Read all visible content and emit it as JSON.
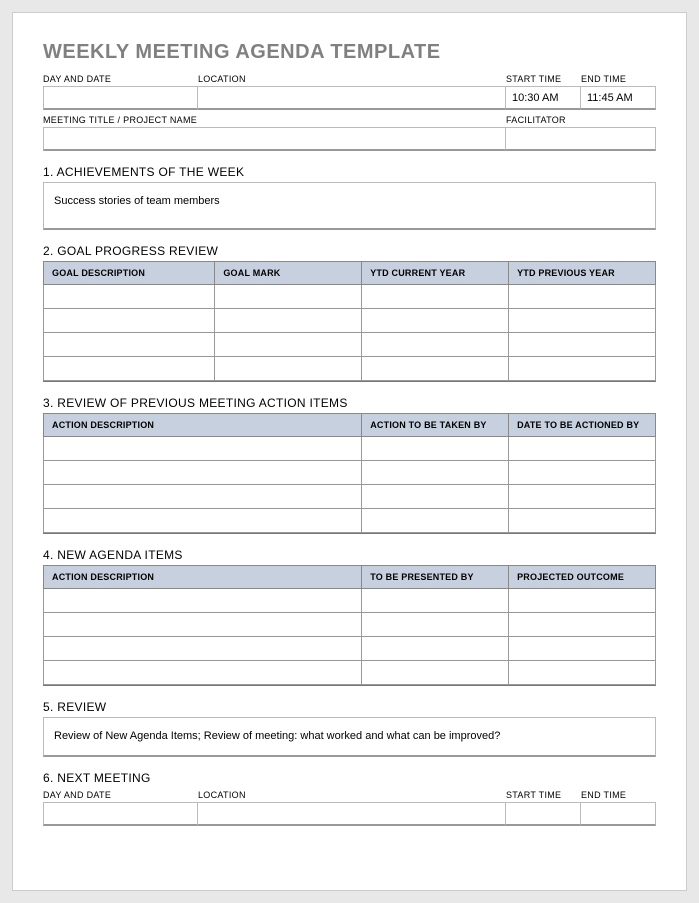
{
  "title": "WEEKLY MEETING AGENDA TEMPLATE",
  "meta1": {
    "day_date_label": "DAY AND DATE",
    "day_date_value": "",
    "location_label": "LOCATION",
    "location_value": "",
    "start_time_label": "START TIME",
    "start_time_value": "10:30 AM",
    "end_time_label": "END TIME",
    "end_time_value": "11:45 AM"
  },
  "meta2": {
    "meeting_title_label": "MEETING TITLE / PROJECT NAME",
    "meeting_title_value": "",
    "facilitator_label": "FACILITATOR",
    "facilitator_value": ""
  },
  "s1": {
    "heading": "1. ACHIEVEMENTS OF THE WEEK",
    "body": "Success stories of team members"
  },
  "s2": {
    "heading": "2. GOAL PROGRESS REVIEW",
    "cols": {
      "c0": "GOAL DESCRIPTION",
      "c1": "GOAL MARK",
      "c2": "YTD CURRENT YEAR",
      "c3": "YTD PREVIOUS YEAR"
    }
  },
  "s3": {
    "heading": "3. REVIEW OF PREVIOUS MEETING ACTION ITEMS",
    "cols": {
      "c0": "ACTION DESCRIPTION",
      "c1": "ACTION TO BE TAKEN BY",
      "c2": "DATE TO BE ACTIONED BY"
    }
  },
  "s4": {
    "heading": "4. NEW AGENDA ITEMS",
    "cols": {
      "c0": "ACTION DESCRIPTION",
      "c1": "TO BE PRESENTED BY",
      "c2": "PROJECTED OUTCOME"
    }
  },
  "s5": {
    "heading": "5. REVIEW",
    "body": "Review of New Agenda Items; Review of meeting: what worked and what can be improved?"
  },
  "s6": {
    "heading": "6. NEXT MEETING",
    "day_date_label": "DAY AND DATE",
    "day_date_value": "",
    "location_label": "LOCATION",
    "location_value": "",
    "start_time_label": "START TIME",
    "start_time_value": "",
    "end_time_label": "END TIME",
    "end_time_value": ""
  }
}
